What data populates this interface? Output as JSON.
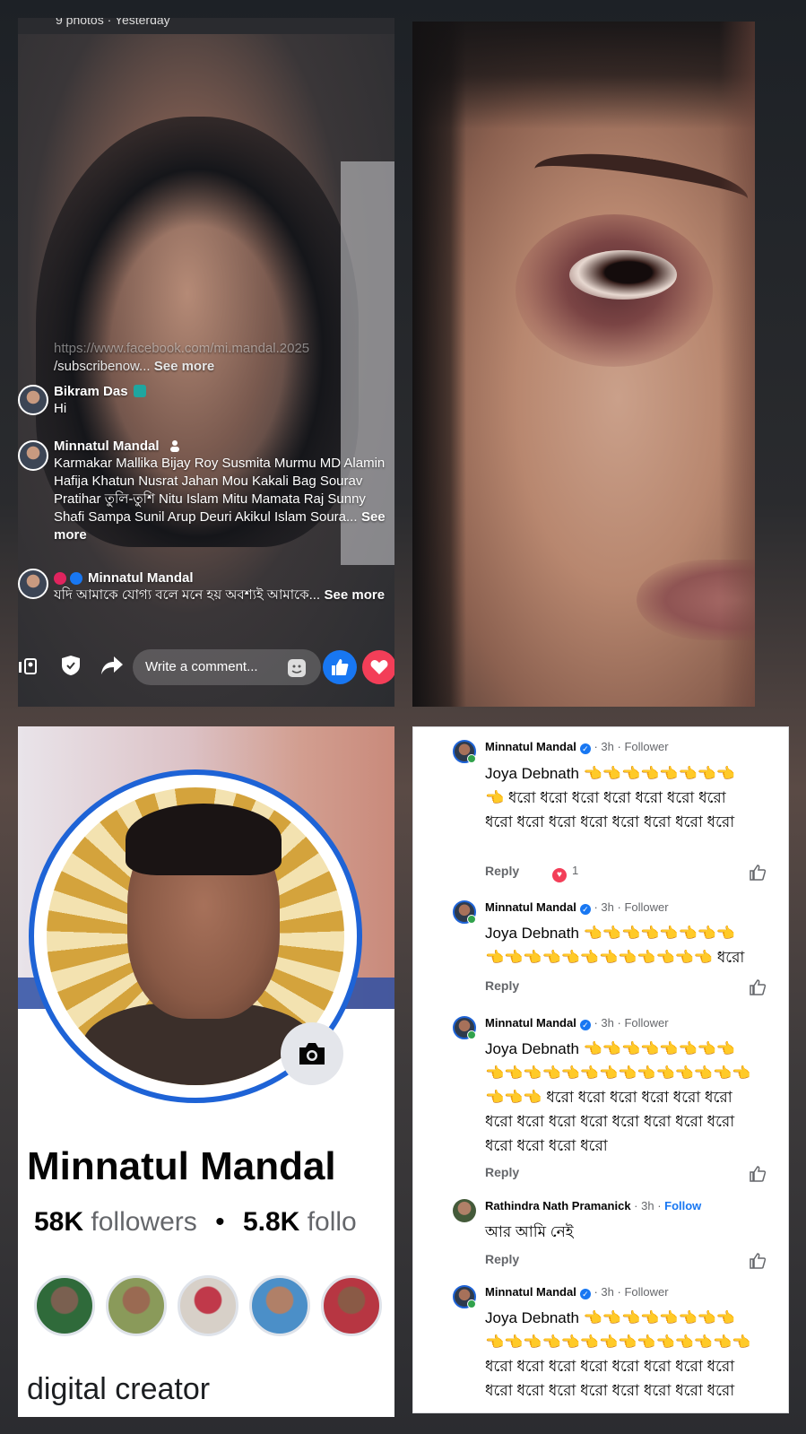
{
  "live": {
    "header": "9 photos · Yesterday",
    "link_text": "https://www.facebook.com/mi.mandal.2025",
    "link_tail": "/subscribenow...",
    "see_more": "See more",
    "comments": [
      {
        "name": "Bikram Das",
        "text": "Hi"
      },
      {
        "name": "Minnatul Mandal",
        "text": "Karmakar Mallika  Bijay Roy Susmita Murmu MD Alamin Hafija Khatun Nusrat Jahan Mou Kakali Bag Sourav Pratihar তুলি-তুশি Nitu Islam Mitu Mamata Raj Sunny Shafi Sampa Sunil Arup Deuri Akikul Islam Soura...",
        "see_more": "See more"
      },
      {
        "name": "Minnatul Mandal",
        "text": "যদি আমাকে যোগ্য বলে মনে হয় অবশ্যই আমাকে...",
        "see_more": "See more"
      }
    ],
    "comment_placeholder": "Write a comment..."
  },
  "profile": {
    "name": "Minnatul Mandal",
    "followers_count": "58K",
    "followers_label": "followers",
    "dot": "•",
    "following_count": "5.8K",
    "following_label": "follo",
    "category": "digital creator"
  },
  "comments": [
    {
      "author": "Minnatul Mandal",
      "time": "3h",
      "badge": "Follower",
      "text": "Joya Debnath 👈👈👈👈👈👈👈👈👈 ধরো ধরো ধরো ধরো ধরো ধরো ধরো ধরো ধরো ধরো ধরো ধরো ধরো ধরো ধরো",
      "reply": "Reply",
      "reactions": "1"
    },
    {
      "author": "Minnatul Mandal",
      "time": "3h",
      "badge": "Follower",
      "text": "Joya Debnath 👈👈👈👈👈👈👈👈👈👈👈👈👈👈👈👈👈👈👈👈 ধরো",
      "reply": "Reply"
    },
    {
      "author": "Minnatul Mandal",
      "time": "3h",
      "badge": "Follower",
      "text": "Joya Debnath 👈👈👈👈👈👈👈👈👈👈👈👈👈👈👈👈👈👈👈👈👈👈👈👈👈 ধরো ধরো ধরো ধরো ধরো ধরো ধরো ধরো ধরো ধরো ধরো ধরো ধরো ধরো ধরো ধরো ধরো ধরো",
      "reply": "Reply"
    },
    {
      "author": "Rathindra Nath Pramanick",
      "time": "3h",
      "badge": "Follow",
      "text": "আর আমি নেই",
      "reply": "Reply"
    },
    {
      "author": "Minnatul Mandal",
      "time": "3h",
      "badge": "Follower",
      "text": "Joya Debnath 👈👈👈👈👈👈👈👈👈👈👈👈👈👈👈👈👈👈👈👈👈👈 ধরো ধরো ধরো ধরো ধরো ধরো ধরো ধরো ধরো ধরো ধরো ধরো ধরো ধরো ধরো ধরো",
      "reply": "Reply"
    }
  ],
  "colors": {
    "fb_blue": "#1877f2",
    "ring_blue": "#1e63d6",
    "heart_red": "#f33e58"
  }
}
